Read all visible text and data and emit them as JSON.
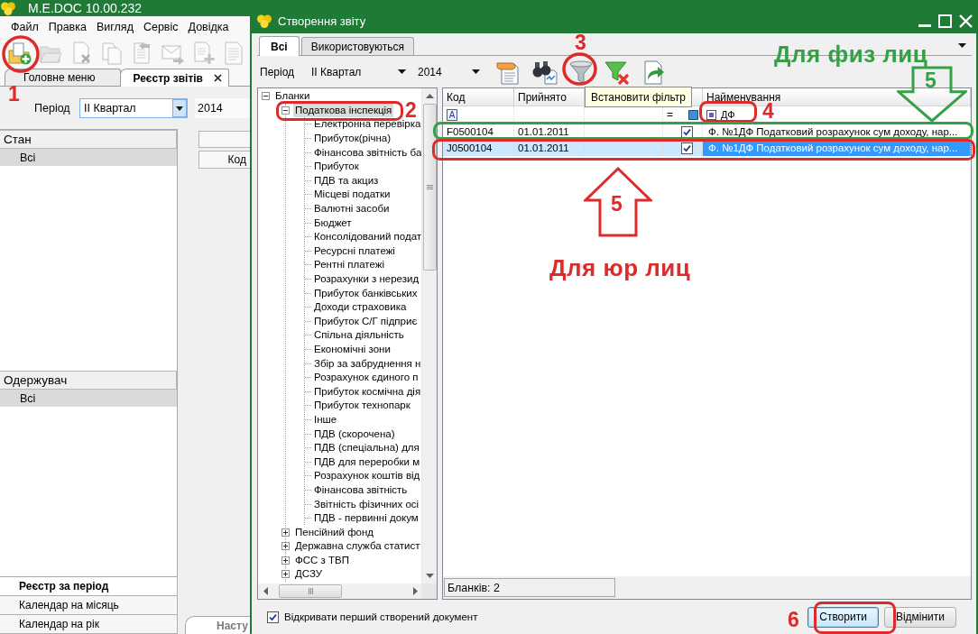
{
  "main_window": {
    "title": "M.E.DOC 10.00.232",
    "menu": [
      "Файл",
      "Правка",
      "Вигляд",
      "Сервіс",
      "Довідка"
    ],
    "toolbar": [
      {
        "disabled": false
      },
      {
        "disabled": true
      },
      {
        "disabled": true
      },
      {
        "disabled": true
      },
      {
        "disabled": true
      },
      {
        "disabled": true
      },
      {
        "disabled": true
      },
      {
        "disabled": true
      }
    ],
    "tabs": [
      {
        "label": "Головне меню",
        "selected": false,
        "closable": false
      },
      {
        "label": "Реєстр звітів",
        "selected": true,
        "closable": true
      }
    ],
    "period": {
      "label": "Період",
      "value": "II Квартал",
      "year": "2014"
    },
    "state_list": {
      "title": "Стан",
      "items": [
        {
          "label": "Всі",
          "selected": true
        }
      ]
    },
    "recipient_list": {
      "title": "Одержувач",
      "items": [
        {
          "label": "Всі",
          "selected": true
        }
      ]
    },
    "grid": {
      "columns": [
        "Код"
      ]
    },
    "views": [
      {
        "label": "Реєстр за період",
        "selected": true
      },
      {
        "label": "Календар на місяць",
        "selected": false
      },
      {
        "label": "Календар на рік",
        "selected": false
      }
    ],
    "bottom_tab": {
      "label": "Насту"
    }
  },
  "dialog": {
    "title": "Створення звіту",
    "tabs": [
      {
        "label": "Всі",
        "selected": true
      },
      {
        "label": "Використовуються",
        "selected": false
      }
    ],
    "period": {
      "label": "Період",
      "value": "II Квартал",
      "year": "2014"
    },
    "tooltip": "Встановити фільтр",
    "tree": [
      {
        "label": "Бланки",
        "expanded": true,
        "selected": false,
        "children": [
          {
            "label": "Податкова інспекція",
            "expanded": true,
            "selected": true,
            "children": [
              {
                "label": "Електронна перевірка",
                "selected": false
              },
              {
                "label": "Прибуток(річна)",
                "selected": false
              },
              {
                "label": "Фінансова звітність ба",
                "selected": false
              },
              {
                "label": "Прибуток",
                "selected": false
              },
              {
                "label": "ПДВ та акциз",
                "selected": false
              },
              {
                "label": "Місцеві податки",
                "selected": false
              },
              {
                "label": "Валютні засоби",
                "selected": false
              },
              {
                "label": "Бюджет",
                "selected": false
              },
              {
                "label": "Консолідований подат",
                "selected": false
              },
              {
                "label": "Ресурсні платежі",
                "selected": false
              },
              {
                "label": "Рентні платежі",
                "selected": false
              },
              {
                "label": "Розрахунки з нерезид",
                "selected": false
              },
              {
                "label": "Прибуток банківських",
                "selected": false
              },
              {
                "label": "Доходи страховика",
                "selected": false
              },
              {
                "label": "Прибуток С/Г підприє",
                "selected": false
              },
              {
                "label": "Спільна діяльність",
                "selected": false
              },
              {
                "label": "Економічні зони",
                "selected": false
              },
              {
                "label": "Збір за забруднення н",
                "selected": false
              },
              {
                "label": "Розрахунок єдиного п",
                "selected": false
              },
              {
                "label": "Прибуток космічна дія",
                "selected": false
              },
              {
                "label": "Прибуток технопарк",
                "selected": false
              },
              {
                "label": "Інше",
                "selected": false
              },
              {
                "label": "ПДВ (скорочена)",
                "selected": false
              },
              {
                "label": "ПДВ (спеціальна) для",
                "selected": false
              },
              {
                "label": "ПДВ для переробки м",
                "selected": false
              },
              {
                "label": "Розрахунок коштів від",
                "selected": false
              },
              {
                "label": "Фінансова звітність",
                "selected": false
              },
              {
                "label": "Звітність фізичних осі",
                "selected": false
              },
              {
                "label": "ПДВ - первинні докум",
                "selected": false
              }
            ]
          },
          {
            "label": "Пенсійний фонд",
            "expanded": false,
            "selected": false
          },
          {
            "label": "Державна служба статист",
            "expanded": false,
            "selected": false
          },
          {
            "label": "ФСС з ТВП",
            "expanded": false,
            "selected": false
          },
          {
            "label": "ДСЗУ",
            "expanded": false,
            "selected": false
          }
        ]
      }
    ],
    "table": {
      "columns": [
        "Код",
        "Прийнято",
        "Найменування"
      ],
      "filter_row": {
        "code_mark": "A",
        "operator": "=",
        "name_indeterminate": true,
        "name_value": "ДФ"
      },
      "rows": [
        {
          "code": "F0500104",
          "accepted": "01.01.2011",
          "checked": true,
          "name": "Ф. №1ДФ Податковий розрахунок сум доходу, нар...",
          "selected": false
        },
        {
          "code": "J0500104",
          "accepted": "01.01.2011",
          "checked": true,
          "name": "Ф. №1ДФ Податковий розрахунок сум доходу, нар...",
          "selected": true
        }
      ],
      "status": "Бланків: 2"
    },
    "open_first": {
      "label": "Відкривати перший створений документ",
      "checked": true
    },
    "buttons": [
      {
        "label": "Створити",
        "default": true
      },
      {
        "label": "Відмінити",
        "default": false
      }
    ]
  },
  "annotations": [
    {
      "kind": "ring",
      "color": "#dd2a2a"
    },
    {
      "kind": "number",
      "text": "1",
      "color": "#dd2a2a"
    },
    {
      "kind": "frame",
      "color": "#dd2a2a"
    },
    {
      "kind": "number",
      "text": "2",
      "color": "#dd2a2a"
    },
    {
      "kind": "number",
      "text": "3",
      "color": "#dd2a2a"
    },
    {
      "kind": "ring",
      "color": "#dd2a2a"
    },
    {
      "kind": "caption",
      "text": "Для физ лиц",
      "color": "#35a048"
    },
    {
      "kind": "arrow_down",
      "text": "5",
      "color": "#35a048"
    },
    {
      "kind": "frame",
      "color": "#dd2a2a"
    },
    {
      "kind": "number",
      "text": "4",
      "color": "#dd2a2a"
    },
    {
      "kind": "frame",
      "color": "#35a048"
    },
    {
      "kind": "frame",
      "color": "#dd2a2a"
    },
    {
      "kind": "arrow_up",
      "text": "5",
      "color": "#dd2a2a"
    },
    {
      "kind": "caption",
      "text": "Для юр лиц",
      "color": "#dd2a2a"
    },
    {
      "kind": "number",
      "text": "6",
      "color": "#dd2a2a"
    },
    {
      "kind": "frame",
      "color": "#dd2a2a"
    }
  ]
}
